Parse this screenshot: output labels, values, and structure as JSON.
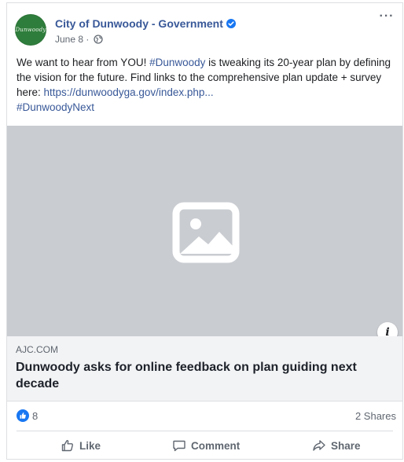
{
  "post": {
    "page_name": "City of Dunwoody - Government",
    "avatar_text": "Dunwoody",
    "date": "June 8",
    "separator": "·",
    "more_label": "···",
    "text_intro": "We want to hear from YOU! ",
    "hashtag1": "#Dunwoody",
    "text_mid": " is tweaking its 20-year plan by defining the vision for the future. Find links to the comprehensive plan update + survey here: ",
    "link_url": "https://dunwoodyga.gov/index.php...",
    "hashtag2": "#DunwoodyNext"
  },
  "link_preview": {
    "domain": "AJC.COM",
    "title": "Dunwoody asks for online feedback on plan guiding next decade",
    "info_label": "i"
  },
  "stats": {
    "reactions": "8",
    "shares": "2 Shares"
  },
  "actions": {
    "like": "Like",
    "comment": "Comment",
    "share": "Share"
  },
  "icons": {
    "verified": "verified-badge-icon",
    "audience": "globe-icon",
    "placeholder": "image-placeholder-icon",
    "reaction": "thumbs-up-icon"
  },
  "colors": {
    "brand_blue": "#1877f2",
    "link": "#385898",
    "secondary_text": "#606770",
    "media_bg": "#c9ccd1",
    "preview_bg": "#f2f3f5"
  }
}
